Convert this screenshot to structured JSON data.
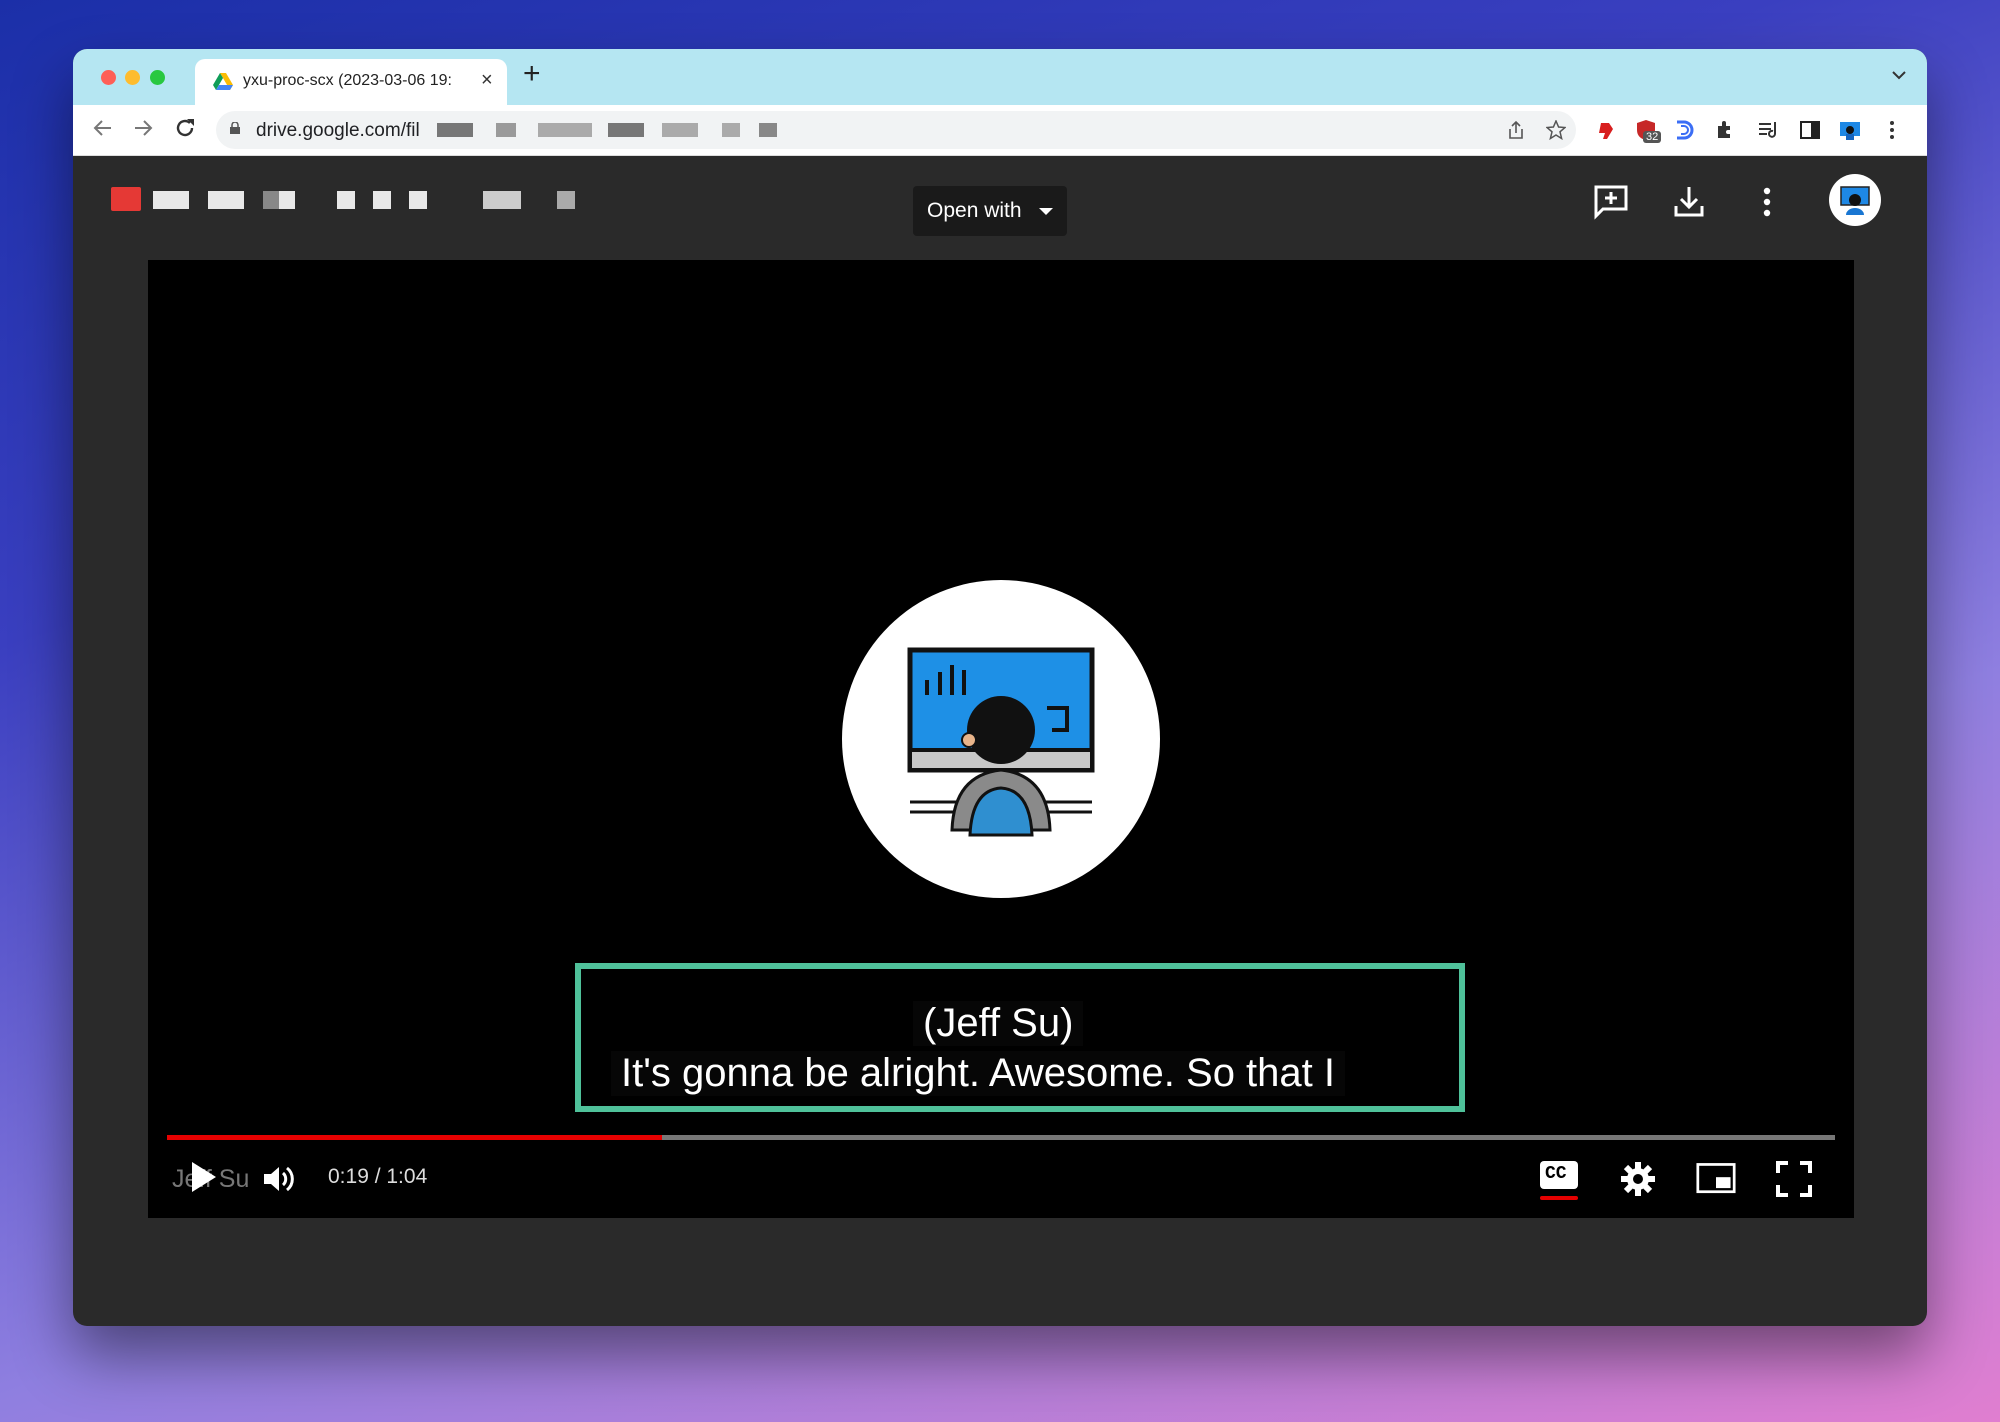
{
  "browser": {
    "tab_title": "yxu-proc-scx (2023-03-06 19:",
    "tab_close": "×",
    "new_tab": "+",
    "url": "drive.google.com/fil",
    "extension_badge": "32"
  },
  "drive": {
    "open_with_label": "Open with"
  },
  "player": {
    "caption_line1": "(Jeff Su)",
    "caption_line2": "It's gonna be alright. Awesome. So that I",
    "watermark": "Jeff Su",
    "time_display": "0:19 / 1:04",
    "progress": 0.297,
    "cc_label": "CC"
  },
  "colors": {
    "progress": "#e60000",
    "caption_highlight": "#4fc19a",
    "tab_strip": "#b5e6f2"
  }
}
